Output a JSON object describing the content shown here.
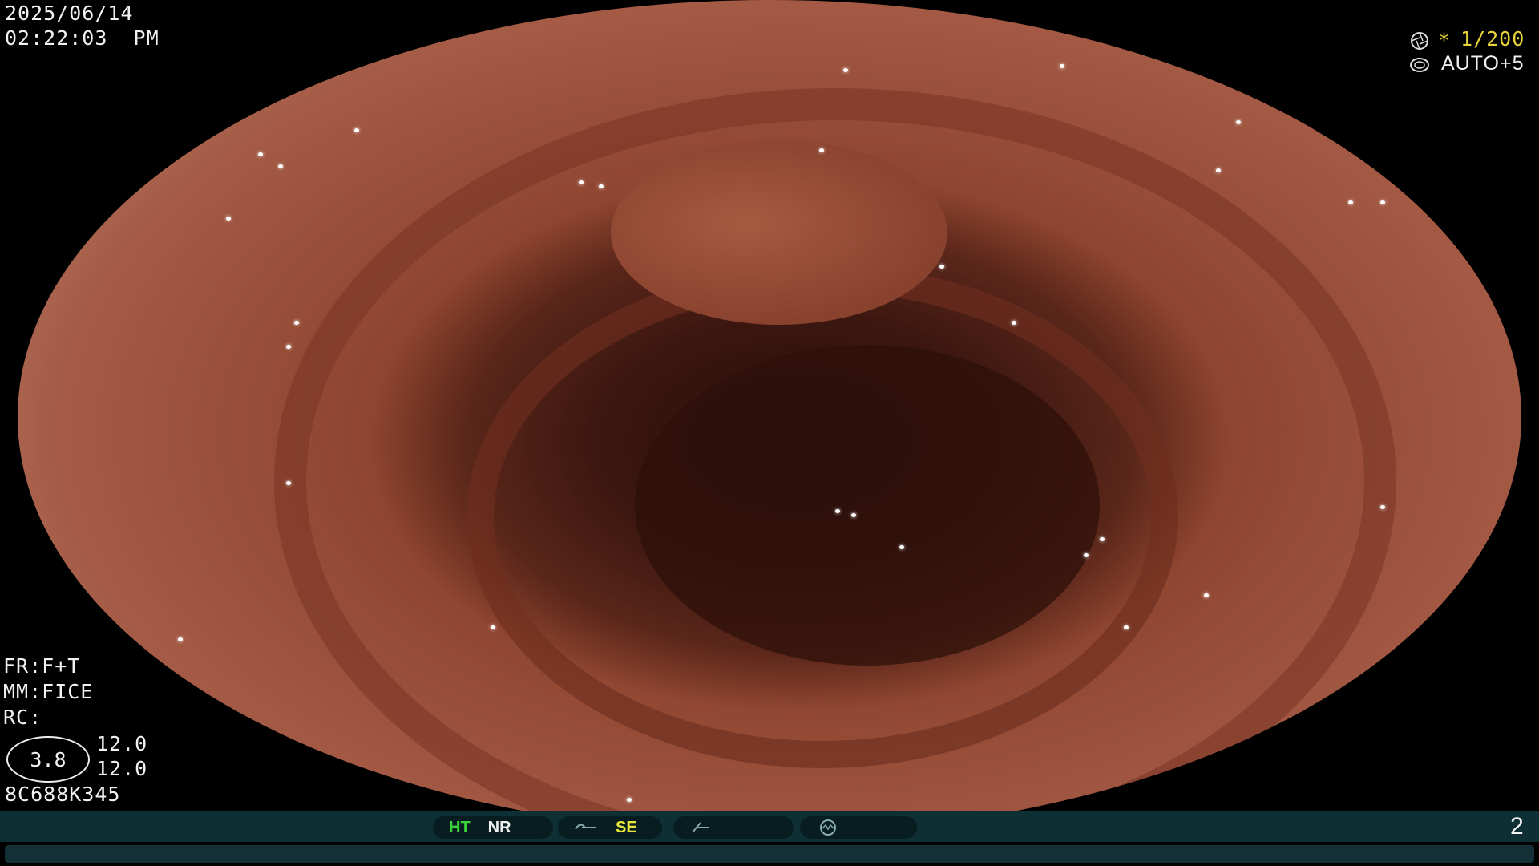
{
  "overlay": {
    "date": "2025/06/14",
    "time": "02:22:03  PM",
    "shutter": "1/200",
    "shutter_mark": "*",
    "exposure": "AUTO+5",
    "fr": "FR:F+T",
    "mm": "MM:FICE",
    "rc": "RC:",
    "ellipse_value": "3.8",
    "value_top": "12.0",
    "value_bottom": "12.0",
    "serial": "8C688K345",
    "page_number": "2"
  },
  "statusbar": {
    "ht": "HT",
    "nr": "NR",
    "se": "SE"
  },
  "colors": {
    "ht": "#3ad13a",
    "se": "#e8e83a",
    "shutter_mark": "#e8d23a"
  },
  "icons": {
    "shutter_icon": "aperture-icon",
    "exposure_icon": "iris-icon",
    "structure_icon": "structure-icon",
    "color_icon": "color-icon",
    "mode_icon": "scope-mode-icon"
  }
}
